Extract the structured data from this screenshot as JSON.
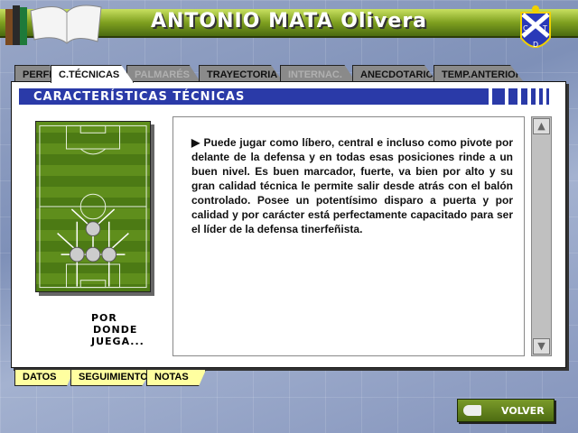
{
  "header": {
    "title": "ANTONIO MATA Olivera",
    "crest_letters": [
      "C",
      "T",
      "D"
    ]
  },
  "tabs": [
    {
      "label": "PERFIL",
      "state": "normal"
    },
    {
      "label": "C.TÉCNICAS",
      "state": "active"
    },
    {
      "label": "PALMARÉS",
      "state": "disabled"
    },
    {
      "label": "TRAYECTORIA",
      "state": "normal"
    },
    {
      "label": "INTERNAC.",
      "state": "disabled"
    },
    {
      "label": "ANECDOTARIO",
      "state": "normal"
    },
    {
      "label": "TEMP.ANTERIOR",
      "state": "normal"
    }
  ],
  "section": {
    "title": "CARACTERÍSTICAS TÉCNICAS"
  },
  "pitch": {
    "caption_lines": [
      "POR",
      "DONDE",
      "JUEGA..."
    ]
  },
  "description": "Puede jugar como líbero, central e incluso como pivote por delante de la defensa y en todas esas posiciones rinde a un buen nivel. Es buen marcador, fuerte, va bien por alto y su gran calidad técnica le permite salir desde atrás con el balón controlado. Posee un potentísimo disparo a puerta y por calidad y por carácter está perfectamente capacitado para ser el líder de la defensa tinerfeñista.",
  "bottom_tabs": [
    "DATOS",
    "SEGUIMIENTO",
    "NOTAS"
  ],
  "volver_label": "VOLVER",
  "colors": {
    "header_green": "#7fa020",
    "section_blue": "#2a3aa8",
    "bottom_tab": "#ffffa0"
  }
}
